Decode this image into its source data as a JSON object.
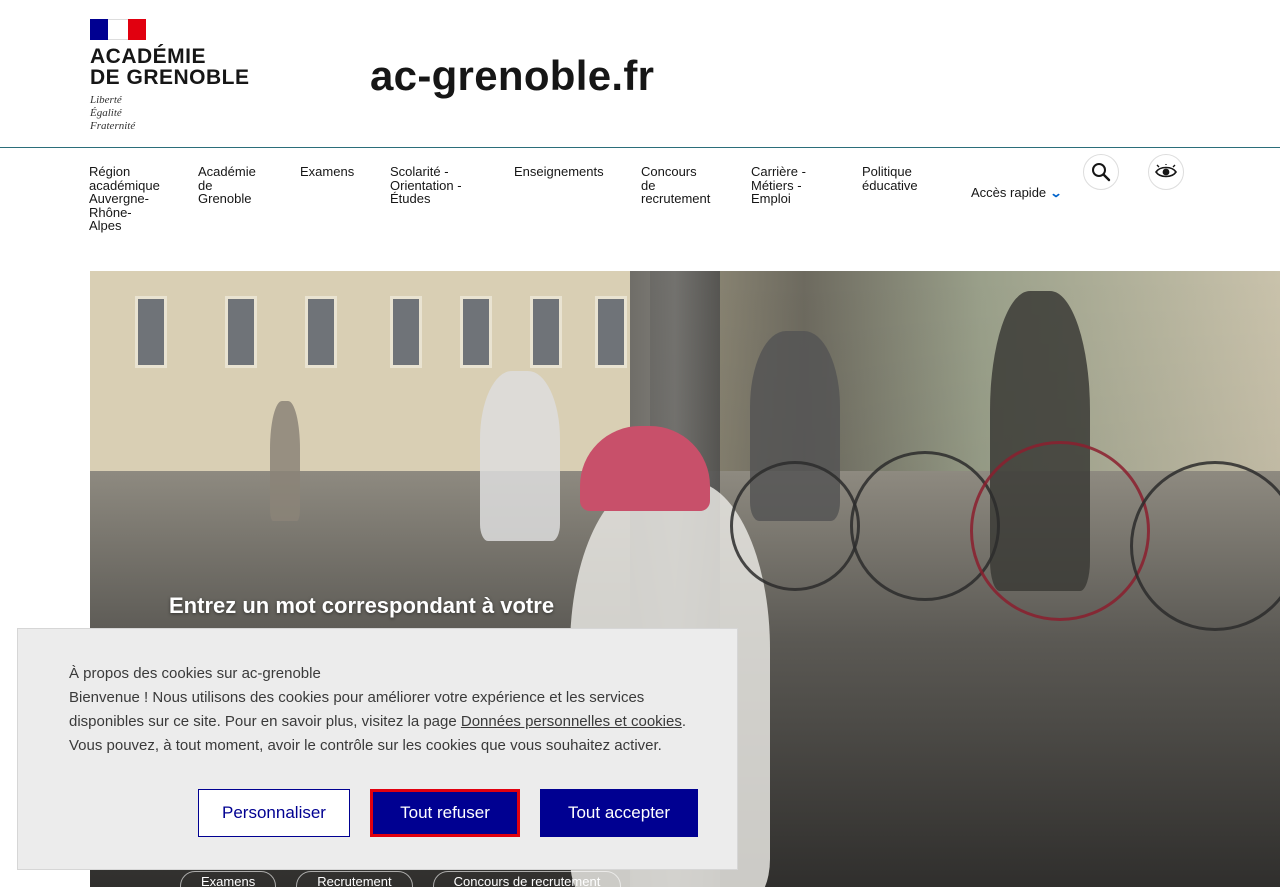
{
  "header": {
    "logo_title_line1": "ACADÉMIE",
    "logo_title_line2": "DE GRENOBLE",
    "motto_line1": "Liberté",
    "motto_line2": "Égalité",
    "motto_line3": "Fraternité",
    "site_name": "ac-grenoble.fr"
  },
  "nav": {
    "items": [
      {
        "label_lines": [
          "Région",
          "académique",
          "Auvergne-",
          "Rhône-",
          "Alpes"
        ]
      },
      {
        "label_lines": [
          "Académie",
          "de",
          "Grenoble"
        ]
      },
      {
        "label_lines": [
          "Examens"
        ]
      },
      {
        "label_lines": [
          "Scolarité -",
          "Orientation -",
          "Études"
        ]
      },
      {
        "label_lines": [
          "Enseignements"
        ]
      },
      {
        "label_lines": [
          "Concours",
          "de",
          "recrutement"
        ]
      },
      {
        "label_lines": [
          "Carrière -",
          "Métiers -",
          "Emploi"
        ]
      },
      {
        "label_lines": [
          "Politique",
          "éducative"
        ]
      }
    ],
    "quick_access": "Accès rapide",
    "search_icon": "search-icon",
    "accessibility_icon": "eye-icon"
  },
  "hero": {
    "search_prompt": "Entrez un mot correspondant à votre",
    "pills": [
      "Examens",
      "Recrutement",
      "Concours de recrutement"
    ]
  },
  "cookie": {
    "title": "À propos des cookies sur ac-grenoble",
    "body_part1": "Bienvenue ! Nous utilisons des cookies pour améliorer votre expérience et les services disponibles sur ce site. Pour en savoir plus, visitez la page ",
    "link_text": "Données personnelles et cookies",
    "body_part2": ".",
    "body_part3": "Vous pouvez, à tout moment, avoir le contrôle sur les cookies que vous souhaitez activer.",
    "personalize_label": "Personnaliser",
    "refuse_label": "Tout refuser",
    "accept_label": "Tout accepter"
  },
  "colors": {
    "primary_blue": "#000091",
    "focus_red": "#e1000f",
    "link_blue": "#0063cb"
  }
}
